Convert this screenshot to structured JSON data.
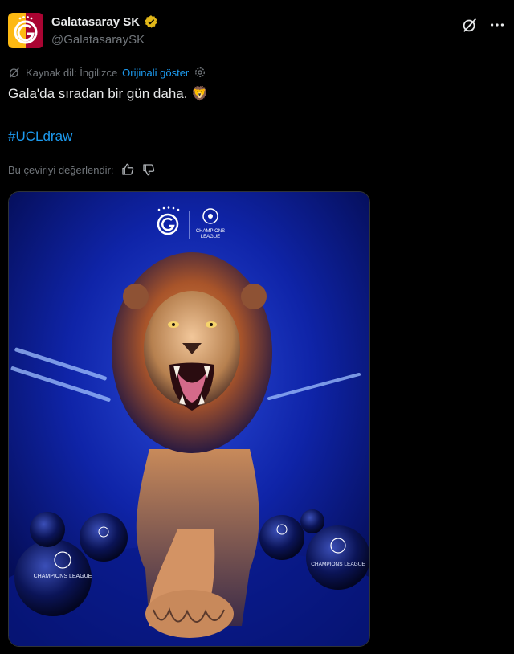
{
  "account": {
    "display_name": "Galatasaray SK",
    "handle": "@GalatasaraySK",
    "avatar_icon": "galatasaray-crest-icon",
    "verified_icon": "verified-gold-badge-icon",
    "colors": {
      "primary": "#a90432",
      "secondary": "#fdb912"
    }
  },
  "actions": {
    "grok_icon": "grok-icon",
    "more_icon": "more-options-icon"
  },
  "translation": {
    "source_label": "Kaynak dil: İngilizce",
    "show_original": "Orijinali göster",
    "settings_icon": "gear-icon"
  },
  "tweet": {
    "text": "Gala'da sıradan bir gün daha.",
    "emoji": "🦁",
    "hashtag": "#UCLdraw"
  },
  "rating": {
    "label": "Bu çeviriyi değerlendir:",
    "like_icon": "thumbs-up-icon",
    "dislike_icon": "thumbs-down-icon"
  },
  "media": {
    "description_icon": "lion-artwork-image",
    "logo_text": "CHAMPIONS LEAGUE",
    "ball_text": "CHAMPIONS LEAGUE"
  },
  "colors": {
    "link": "#1d9bf0",
    "muted": "#71767b",
    "text": "#e7e9ea",
    "background": "#000000"
  }
}
